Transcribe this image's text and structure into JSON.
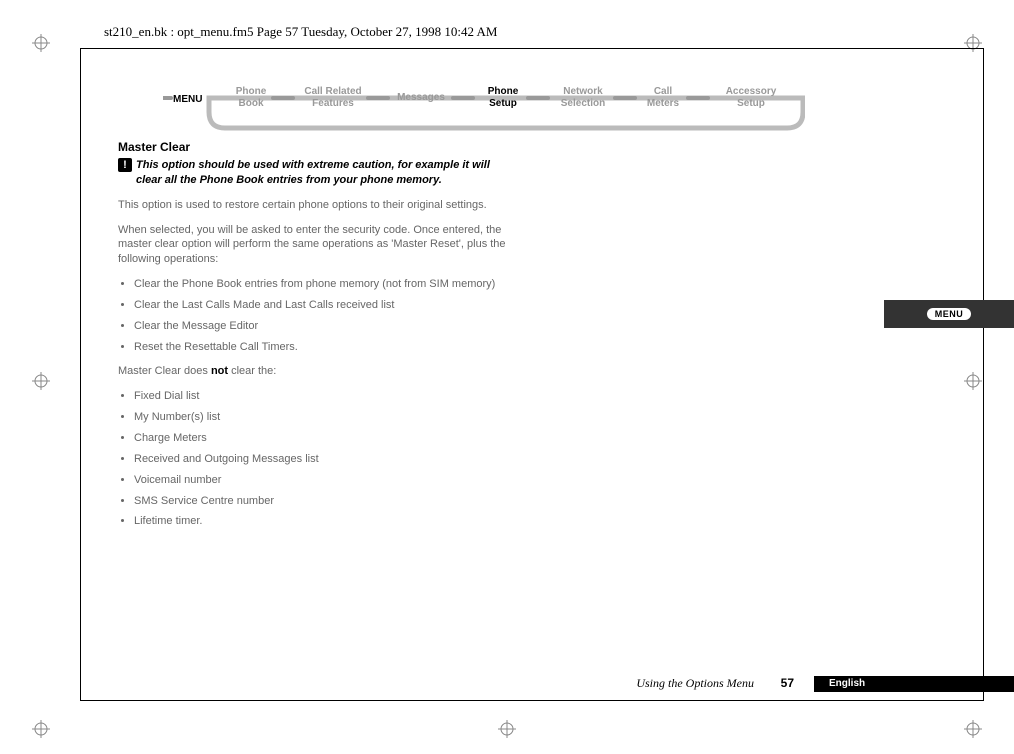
{
  "file_header": "st210_en.bk : opt_menu.fm5  Page 57  Tuesday, October 27, 1998  10:42 AM",
  "menu": {
    "root": "MENU",
    "items": [
      {
        "top": "Phone",
        "bottom": "Book",
        "active": false
      },
      {
        "top": "Call Related",
        "bottom": "Features",
        "active": false
      },
      {
        "top": "Messages",
        "bottom": "",
        "active": false
      },
      {
        "top": "Phone",
        "bottom": "Setup",
        "active": true
      },
      {
        "top": "Network",
        "bottom": "Selection",
        "active": false
      },
      {
        "top": "Call",
        "bottom": "Meters",
        "active": false
      },
      {
        "top": "Accessory",
        "bottom": "Setup",
        "active": false
      }
    ]
  },
  "section_title": "Master Clear",
  "warning_icon": "!",
  "warning_text": "This option should be used with extreme caution, for example it will clear all the Phone Book entries from your phone memory.",
  "para1": "This option is used to restore certain phone options to their original settings.",
  "para2": "When selected, you will be asked to enter the security code. Once entered, the master clear option will perform the same operations as 'Master Reset', plus the following operations:",
  "list1": [
    "Clear the Phone Book entries from phone memory (not from SIM memory)",
    "Clear the Last Calls Made and Last Calls received list",
    "Clear the Message Editor",
    "Reset the Resettable Call Timers."
  ],
  "not_word": "not",
  "para3_before": "Master Clear does ",
  "para3_after": " clear the:",
  "list2": [
    "Fixed Dial list",
    "My Number(s) list",
    "Charge Meters",
    "Received and Outgoing Messages list",
    "Voicemail number",
    "SMS Service Centre number",
    "Lifetime timer."
  ],
  "footer": {
    "running_title": "Using the Options Menu",
    "page_number": "57",
    "language": "English"
  },
  "side_tab": "MENU"
}
